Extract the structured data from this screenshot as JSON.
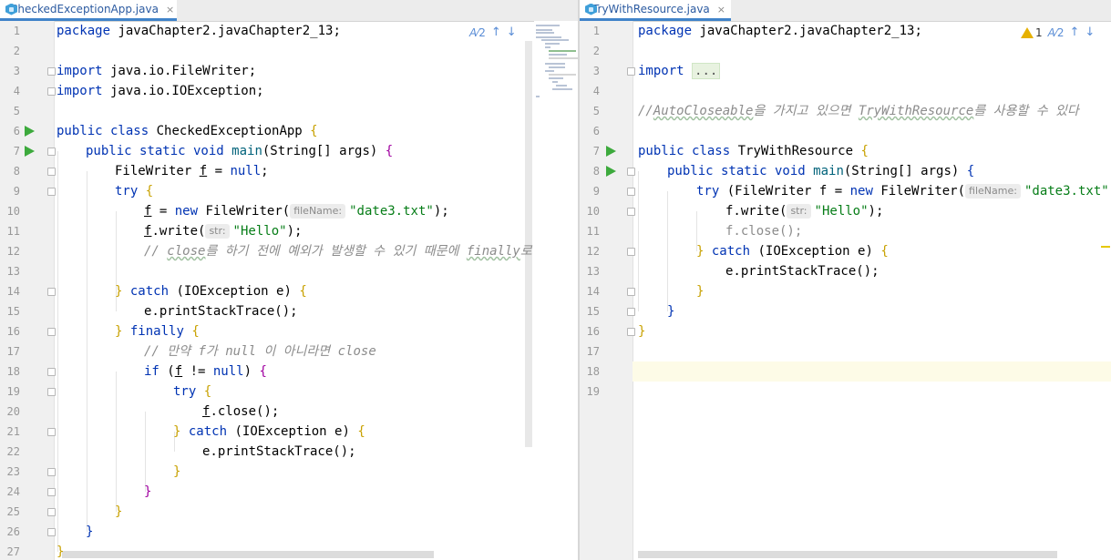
{
  "left": {
    "tab": {
      "name": "CheckedExceptionApp.java",
      "close": "×"
    },
    "inspection": {
      "typo_count": "2",
      "up": "↑",
      "down": "↓"
    },
    "line_numbers": [
      "1",
      "2",
      "3",
      "4",
      "5",
      "6",
      "7",
      "8",
      "9",
      "10",
      "11",
      "12",
      "13",
      "14",
      "15",
      "16",
      "17",
      "18",
      "19",
      "20",
      "21",
      "22",
      "23",
      "24",
      "25",
      "26",
      "27"
    ]
  },
  "right": {
    "tab": {
      "name": "TryWithResource.java",
      "close": "×"
    },
    "inspection": {
      "warning_count": "1",
      "typo_count": "2",
      "up": "↑",
      "down": "↓"
    },
    "line_numbers": [
      "1",
      "2",
      "3",
      "4",
      "5",
      "6",
      "7",
      "8",
      "9",
      "10",
      "11",
      "12",
      "13",
      "14",
      "15",
      "16",
      "17",
      "18",
      "19"
    ]
  },
  "code_text": {
    "package_line": "package javaChapter2.javaChapter2_13;",
    "import_filewriter": "import java.io.FileWriter;",
    "import_ioexception": "import java.io.IOException;",
    "class_checked": "public class CheckedExceptionApp {",
    "main_sig": "public static void main(String[] args) {",
    "fw_decl": "FileWriter f = null;",
    "try_open": "try {",
    "new_fw": "f = new FileWriter(",
    "param_filename": "fileName:",
    "date3": "\"date3.txt\"",
    "write_call": "f.write(",
    "param_str": "str:",
    "hello": "\"Hello\"",
    "comment_close": "// close를 하기 전에 예외가 발생할 수 있기 때문에 finally로",
    "catch_open": "} catch (IOException e) {",
    "print_trace": "e.printStackTrace();",
    "finally_open": "} finally {",
    "comment_null": "// 만약 f가 null 이 아니라면 close",
    "if_open": "if (f != null) {",
    "close_call": "f.close();",
    "close_brace": "}",
    "import_folded": "import ...",
    "comment_autocloseable": "//AutoCloseable을 가지고 있으면 TryWithResource를 사용할 수 있다",
    "class_twr": "public class TryWithResource {",
    "try_res_open": "try (FileWriter f = new FileWriter("
  },
  "colors": {
    "keyword": "#0033b3",
    "string": "#067d17",
    "comment": "#8c8c8c",
    "run_icon": "#3daa3d",
    "tab_underline": "#4083c9",
    "warning": "#e6b100"
  }
}
